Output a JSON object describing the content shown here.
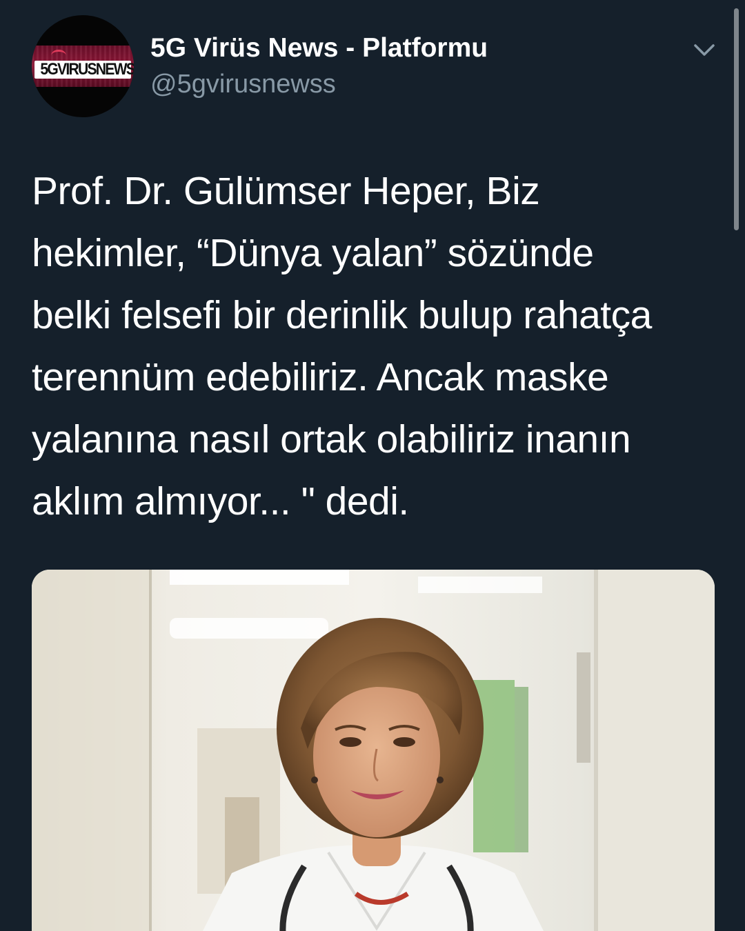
{
  "tweet": {
    "author": {
      "display_name": "5G Virüs News - Platformu",
      "handle": "@5gvirusnewss",
      "avatar_logo_text": "5GVIRUSNEWS"
    },
    "text_lines": [
      "Prof. Dr. Gūlümser Heper, Biz",
      "hekimler, “Dünya yalan” sözünde",
      "belki felsefi bir derinlik bulup rahatça",
      "terennüm edebiliriz. Ancak maske",
      "yalanına nasıl ortak olabiliriz inanın",
      "aklım almıyor... \" dedi."
    ],
    "media": {
      "type": "photo",
      "description_icon": "photo-icon"
    }
  },
  "icons": {
    "menu": "chevron-down-icon"
  },
  "colors": {
    "background": "#15202b",
    "primary_text": "#ffffff",
    "secondary_text": "#8899a6"
  }
}
